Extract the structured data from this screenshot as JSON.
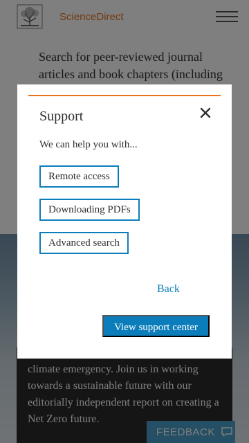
{
  "header": {
    "brand": "ScienceDirect",
    "logo_icon": "elsevier-tree-icon",
    "menu_icon": "hamburger-menu-icon"
  },
  "search": {
    "description": "Search for peer-reviewed journal articles and book chapters (including"
  },
  "hero": {
    "text": "climate emergency. Join us in working towards a sustainable future with our editorially independent report on creating a Net Zero future."
  },
  "feedback": {
    "label": "FEEDBACK",
    "icon": "chat-bubble-icon"
  },
  "modal": {
    "title": "Support",
    "close_icon": "close-icon",
    "intro": "We can help you with...",
    "options": [
      {
        "label": "Remote access"
      },
      {
        "label": "Downloading PDFs"
      },
      {
        "label": "Advanced search"
      }
    ],
    "back_label": "Back",
    "support_center_label": "View support center"
  },
  "colors": {
    "accent_orange": "#e9711c",
    "link_blue": "#0c7dbb",
    "feedback_blue": "#4a9ec8",
    "overlay": "rgba(0,0,0,0.5)"
  }
}
